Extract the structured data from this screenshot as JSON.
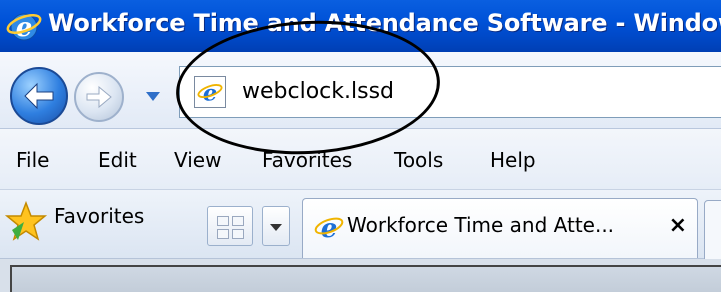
{
  "window": {
    "title": "Workforce Time and Attendance Software - Windows"
  },
  "address_bar": {
    "url": "webclock.lssd",
    "icon": "ie-page-icon"
  },
  "menu": {
    "items": [
      "File",
      "Edit",
      "View",
      "Favorites",
      "Tools",
      "Help"
    ]
  },
  "favorites_bar": {
    "favorites_label": "Favorites",
    "tab": {
      "title": "Workforce Time and Atte...",
      "close_glyph": "×"
    }
  },
  "colors": {
    "titlebar": "#0052d8",
    "toolbar": "#e2eaf6",
    "callout": "#000000"
  }
}
